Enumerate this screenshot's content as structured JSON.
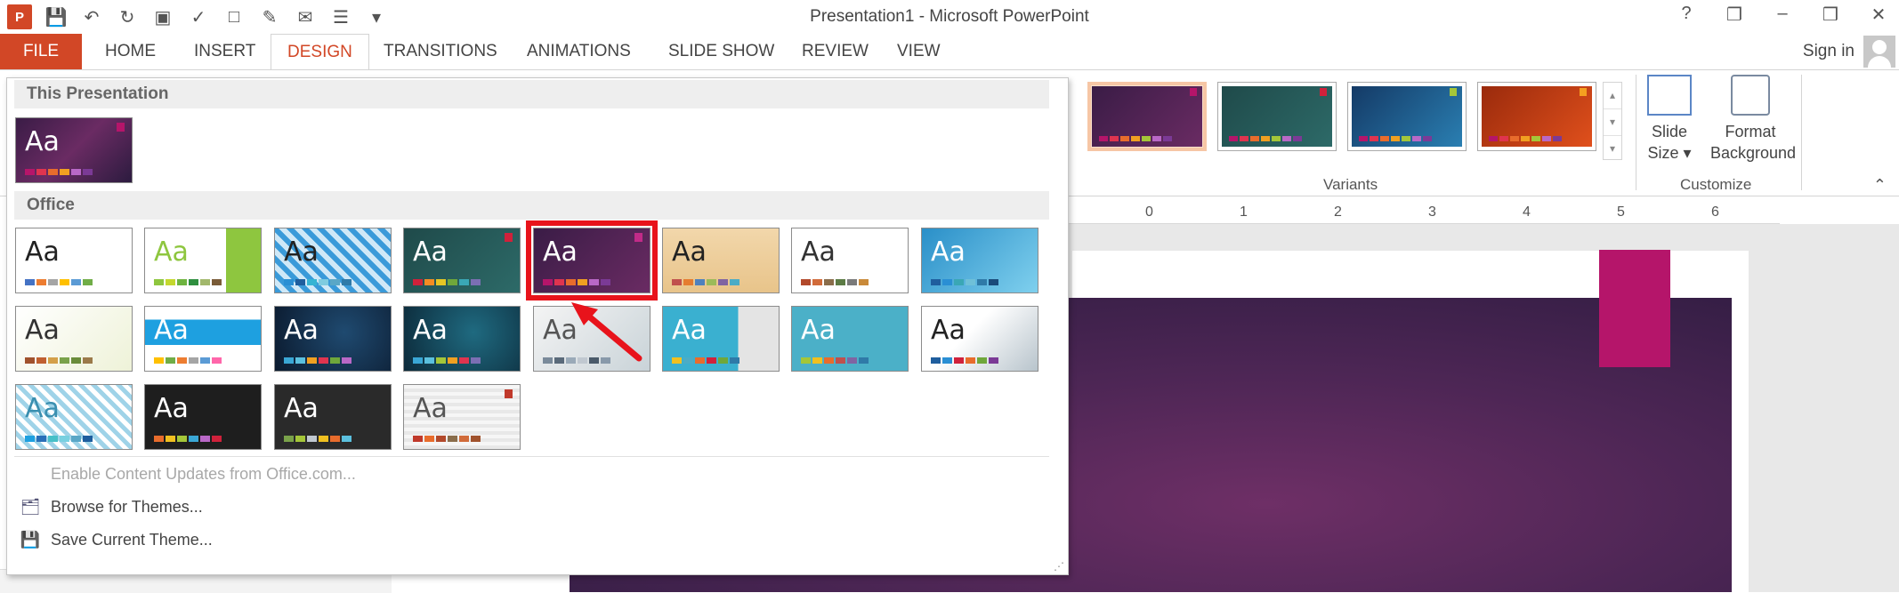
{
  "window": {
    "title": "Presentation1 - Microsoft PowerPoint",
    "controls": [
      "?",
      "❐",
      "–",
      "❒",
      "✕"
    ]
  },
  "qat": [
    {
      "name": "save-icon",
      "glyph": "💾"
    },
    {
      "name": "undo-icon",
      "glyph": "↶"
    },
    {
      "name": "redo-icon",
      "glyph": "↻"
    },
    {
      "name": "from-beginning-icon",
      "glyph": "▣"
    },
    {
      "name": "spelling-icon",
      "glyph": "✓"
    },
    {
      "name": "new-icon",
      "glyph": "□"
    },
    {
      "name": "format-painter-icon",
      "glyph": "✎"
    },
    {
      "name": "attach-icon",
      "glyph": "✉"
    },
    {
      "name": "new-slide-icon",
      "glyph": "☰"
    },
    {
      "name": "customize-qat-icon",
      "glyph": "▾"
    }
  ],
  "tabs": {
    "file": "FILE",
    "items": [
      "HOME",
      "INSERT",
      "DESIGN",
      "TRANSITIONS",
      "ANIMATIONS",
      "SLIDE SHOW",
      "REVIEW",
      "VIEW"
    ],
    "active": "DESIGN"
  },
  "signin": "Sign in",
  "ribbon": {
    "variants_label": "Variants",
    "customize_label": "Customize",
    "slide_size": [
      "Slide",
      "Size ▾"
    ],
    "format_background": [
      "Format",
      "Background"
    ],
    "variants": [
      {
        "bg": [
          "#3a1c46",
          "#6a2b63"
        ],
        "accent": "#b5156a",
        "selected": true
      },
      {
        "bg": [
          "#1f4a4a",
          "#2d6a68"
        ],
        "accent": "#d0213b",
        "selected": false
      },
      {
        "bg": [
          "#143a66",
          "#2a7fb2"
        ],
        "accent": "#a4c639",
        "selected": false
      },
      {
        "bg": [
          "#9a2a0c",
          "#e0501c"
        ],
        "accent": "#f4a020",
        "selected": false
      }
    ]
  },
  "ruler": [
    "0",
    "1",
    "2",
    "3",
    "4",
    "5",
    "6"
  ],
  "dropdown": {
    "sections": [
      "This Presentation",
      "Office"
    ],
    "menu": [
      {
        "label": "Enable Content Updates from Office.com...",
        "disabled": true,
        "icon": ""
      },
      {
        "label": "Browse for Themes...",
        "disabled": false,
        "icon": "browse-themes-icon"
      },
      {
        "label": "Save Current Theme...",
        "disabled": false,
        "icon": "save-theme-icon"
      }
    ],
    "current_theme": {
      "text": "Aa",
      "bg": "linear-gradient(135deg,#3a1c46,#6a2b63,#2c1b3f)",
      "fg": "#fff",
      "accent": "#b5156a",
      "bars": [
        "#b5156a",
        "#e0344f",
        "#e86c2c",
        "#f0a021",
        "#b968c7",
        "#7b3a96"
      ]
    },
    "themes": [
      {
        "text": "Aa",
        "bg": "#ffffff",
        "fg": "#222",
        "accent": "",
        "bars": [
          "#4472c4",
          "#ed7d31",
          "#a5a5a5",
          "#ffc000",
          "#5b9bd5",
          "#70ad47"
        ]
      },
      {
        "text": "Aa",
        "bg": "linear-gradient(90deg,#ffffff 70%,#8ec63f 70%)",
        "fg": "#8ec63f",
        "accent": "",
        "bars": [
          "#8ec63f",
          "#c4d82e",
          "#6eb43f",
          "#2f8f3f",
          "#a2b86c",
          "#7a5c38"
        ]
      },
      {
        "text": "Aa",
        "bg": "repeating-linear-gradient(45deg,#3a9ad9 0 6px,#cfe8f7 6px 12px)",
        "fg": "#222",
        "accent": "",
        "bars": [
          "#2a8fd4",
          "#1f5e9e",
          "#36b4d3",
          "#7ecbe0",
          "#5aa7c7",
          "#2f7aa8"
        ]
      },
      {
        "text": "Aa",
        "bg": "linear-gradient(135deg,#1f4a4a,#2d6a68)",
        "fg": "#fff",
        "accent": "#d0213b",
        "bars": [
          "#d0213b",
          "#f58c23",
          "#e6c624",
          "#6fa73b",
          "#3aa7b5",
          "#7b6fb3"
        ]
      },
      {
        "text": "Aa",
        "bg": "linear-gradient(135deg,#3a1c46,#6a2b63)",
        "fg": "#fff",
        "accent": "#c12b88",
        "bars": [
          "#b5156a",
          "#e0344f",
          "#e86c2c",
          "#f0a021",
          "#b968c7",
          "#7b3a96"
        ],
        "highlight": true
      },
      {
        "text": "Aa",
        "bg": "linear-gradient(180deg,#f2d7ab,#e8c48a)",
        "fg": "#222",
        "accent": "",
        "bars": [
          "#c0504d",
          "#e57c2f",
          "#4f81bd",
          "#9bbb59",
          "#8064a2",
          "#4bacc6"
        ]
      },
      {
        "text": "Aa",
        "bg": "#ffffff",
        "fg": "#333",
        "accent": "",
        "bars": [
          "#b2492b",
          "#d16b3a",
          "#8a6d4b",
          "#5c7b45",
          "#7a7a7a",
          "#c98a3a"
        ]
      },
      {
        "text": "Aa",
        "bg": "linear-gradient(135deg,#2a8fc8,#7fd0ee)",
        "fg": "#fff",
        "accent": "",
        "bars": [
          "#1f5e9e",
          "#2a8fd4",
          "#3aa7b5",
          "#6fc0d8",
          "#2f7aa8",
          "#1a4a7a"
        ]
      },
      {
        "text": "Aa",
        "bg": "linear-gradient(135deg,#ffffff,#eef2d8)",
        "fg": "#333",
        "accent": "",
        "bars": [
          "#a0522d",
          "#c06030",
          "#d4a04a",
          "#7aa24a",
          "#6a8c3a",
          "#9b7a4a"
        ]
      },
      {
        "text": "Aa",
        "bg": "linear-gradient(180deg,#ffffff 20%,#1ea0e0 20%,#1ea0e0 60%,#ffffff 60%)",
        "fg": "#fff",
        "accent": "",
        "bars": [
          "#ffc000",
          "#70ad47",
          "#ed7d31",
          "#a5a5a5",
          "#5b9bd5",
          "#ff66aa"
        ]
      },
      {
        "text": "Aa",
        "bg": "radial-gradient(circle at 60% 40%,#1f4a70,#0b1a2e)",
        "fg": "#fff",
        "accent": "",
        "bars": [
          "#3aa7d5",
          "#5bc0de",
          "#f0a021",
          "#e0344f",
          "#6fa73b",
          "#b968c7"
        ]
      },
      {
        "text": "Aa",
        "bg": "radial-gradient(circle at 60% 40%,#1f6a80,#0c2a3a)",
        "fg": "#fff",
        "accent": "",
        "bars": [
          "#3aa7d5",
          "#5bc0de",
          "#a4c639",
          "#f0a021",
          "#e0344f",
          "#7b6fb3"
        ]
      },
      {
        "text": "Aa",
        "bg": "linear-gradient(135deg,#f4f4f4,#c9d3d8)",
        "fg": "#555",
        "accent": "",
        "bars": [
          "#7a8a9a",
          "#5a6a7a",
          "#9aaab8",
          "#c0c8d0",
          "#4a5a6a",
          "#8899aa"
        ]
      },
      {
        "text": "Aa",
        "bg": "linear-gradient(90deg,#3ab0d0 65%,#e4e4e4 65%)",
        "fg": "#fff",
        "accent": "",
        "bars": [
          "#f0c020",
          "#4bacc6",
          "#e86c2c",
          "#d0213b",
          "#6fa73b",
          "#2f7aa8"
        ]
      },
      {
        "text": "Aa",
        "bg": "#4bb0c8",
        "fg": "#fff",
        "accent": "",
        "bars": [
          "#a4c639",
          "#f0c020",
          "#e86c2c",
          "#c0504d",
          "#8064a2",
          "#2f7aa8"
        ]
      },
      {
        "text": "Aa",
        "bg": "linear-gradient(135deg,#ffffff 40%,#b8c4cc 100%)",
        "fg": "#222",
        "accent": "",
        "bars": [
          "#1f5e9e",
          "#2a8fd4",
          "#d0213b",
          "#e86c2c",
          "#6fa73b",
          "#7b3a96"
        ]
      },
      {
        "text": "Aa",
        "bg": "repeating-linear-gradient(45deg,#9fd3e8 0 5px,#ffffff 5px 10px)",
        "fg": "#3a8fb0",
        "accent": "",
        "bars": [
          "#1ea0e0",
          "#2a6fb8",
          "#48c0c8",
          "#78d0e0",
          "#5aa7c7",
          "#1f5e9e"
        ]
      },
      {
        "text": "Aa",
        "bg": "#1e1e1e",
        "fg": "#fff",
        "accent": "",
        "bars": [
          "#e86c2c",
          "#f0c020",
          "#a4c639",
          "#3aa7d5",
          "#b968c7",
          "#d0213b"
        ]
      },
      {
        "text": "Aa",
        "bg": "#2a2a2a",
        "fg": "#fff",
        "accent": "",
        "bars": [
          "#7aa24a",
          "#a4c639",
          "#c0c8d0",
          "#f0c020",
          "#e86c2c",
          "#5bc0de"
        ]
      },
      {
        "text": "Aa",
        "bg": "repeating-linear-gradient(0deg,#e8e8e8 0 4px,#f6f6f6 4px 8px)",
        "fg": "#555",
        "accent": "#c0392b",
        "bars": [
          "#c0392b",
          "#e86c2c",
          "#b2492b",
          "#8a6d4b",
          "#d16b3a",
          "#a0522d"
        ]
      }
    ]
  },
  "colors": {
    "file_tab": "#d24726",
    "highlight": "#e8131b",
    "slide_tab": "#b5156a"
  }
}
